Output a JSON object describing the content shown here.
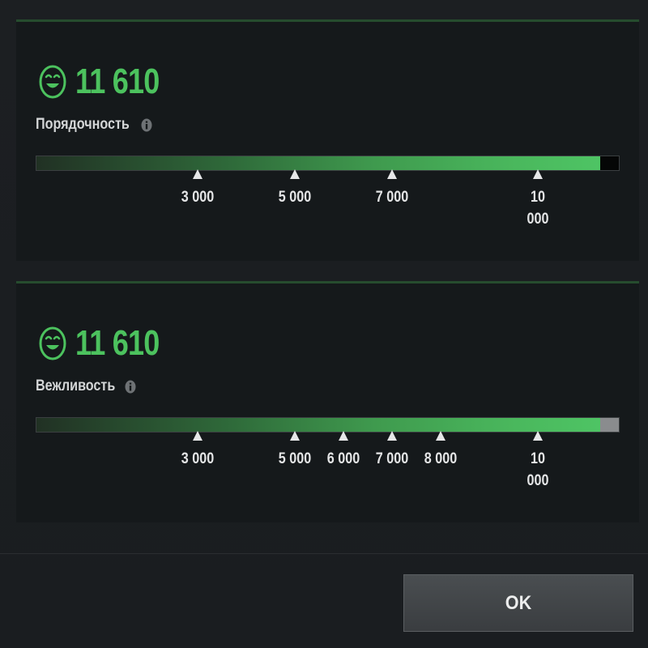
{
  "panels": [
    {
      "score": "11 610",
      "label": "Порядочность",
      "progress_fraction": 0.968,
      "cap_color": "#050606",
      "icons": {
        "status": "smiley-face-icon",
        "info": "info-icon"
      },
      "markers": [
        {
          "label": "3 000",
          "value": 3000
        },
        {
          "label": "5 000",
          "value": 5000
        },
        {
          "label": "7 000",
          "value": 7000
        },
        {
          "label": "10\n000",
          "value": 10000
        }
      ]
    },
    {
      "score": "11 610",
      "label": "Вежливость",
      "progress_fraction": 0.968,
      "cap_color": "#8a8c8e",
      "icons": {
        "status": "smiley-face-icon",
        "info": "info-icon"
      },
      "markers": [
        {
          "label": "3 000",
          "value": 3000
        },
        {
          "label": "5 000",
          "value": 5000
        },
        {
          "label": "6 000",
          "value": 6000
        },
        {
          "label": "7 000",
          "value": 7000
        },
        {
          "label": "8 000",
          "value": 8000
        },
        {
          "label": "10\n000",
          "value": 10000
        }
      ]
    }
  ],
  "colors": {
    "accent": "#4cc25e",
    "panel_border": "#264c2e",
    "panel_bg": "#15191b"
  },
  "footer": {
    "ok_label": "OK"
  }
}
